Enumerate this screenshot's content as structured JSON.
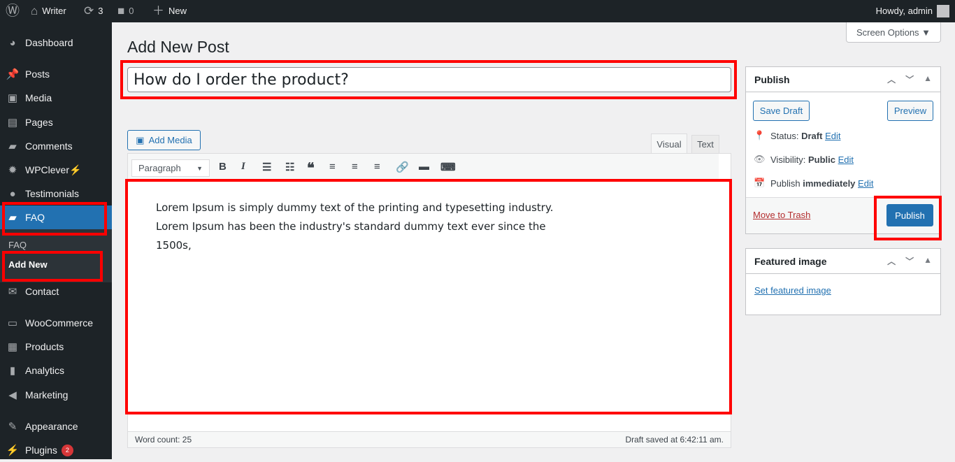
{
  "adminbar": {
    "site": "Writer",
    "updates": "3",
    "comments": "0",
    "new": "New",
    "howdy": "Howdy, admin"
  },
  "sidebar": {
    "items": [
      {
        "label": "Dashboard",
        "icon": "dashboard-icon"
      },
      {
        "label": "Posts",
        "icon": "pin-icon"
      },
      {
        "label": "Media",
        "icon": "media-icon"
      },
      {
        "label": "Pages",
        "icon": "pages-icon"
      },
      {
        "label": "Comments",
        "icon": "comment-icon"
      },
      {
        "label": "WPClever⚡",
        "icon": "bulb-icon"
      },
      {
        "label": "Testimonials",
        "icon": "user-icon"
      },
      {
        "label": "FAQ",
        "icon": "folder-icon"
      },
      {
        "label": "Contact",
        "icon": "mail-icon"
      },
      {
        "label": "WooCommerce",
        "icon": "woo-icon"
      },
      {
        "label": "Products",
        "icon": "archive-icon"
      },
      {
        "label": "Analytics",
        "icon": "chart-icon"
      },
      {
        "label": "Marketing",
        "icon": "megaphone-icon"
      },
      {
        "label": "Appearance",
        "icon": "brush-icon"
      },
      {
        "label": "Plugins",
        "icon": "plug-icon",
        "badge": "2"
      }
    ],
    "submenu": [
      "FAQ",
      "Add New"
    ]
  },
  "screen_options": "Screen Options ▼",
  "page_title": "Add New Post",
  "post_title": "How do I order the product?",
  "editor": {
    "add_media": "Add Media",
    "tab_visual": "Visual",
    "tab_text": "Text",
    "format": "Paragraph",
    "content": "Lorem Ipsum is simply dummy text of the printing and typesetting industry. Lorem Ipsum has been the industry's standard dummy text ever since the 1500s,",
    "word_count": "Word count: 25",
    "saved": "Draft saved at 6:42:11 am."
  },
  "publish": {
    "title": "Publish",
    "save_draft": "Save Draft",
    "preview": "Preview",
    "status_label": "Status:",
    "status": "Draft",
    "visibility_label": "Visibility:",
    "visibility": "Public",
    "publish_label": "Publish",
    "publish_when": "immediately",
    "edit": "Edit",
    "trash": "Move to Trash",
    "publish_btn": "Publish"
  },
  "featured": {
    "title": "Featured image",
    "link": "Set featured image"
  },
  "colors": {
    "accent": "#2271b1",
    "highlight": "#ff0000",
    "bar": "#1d2327"
  }
}
